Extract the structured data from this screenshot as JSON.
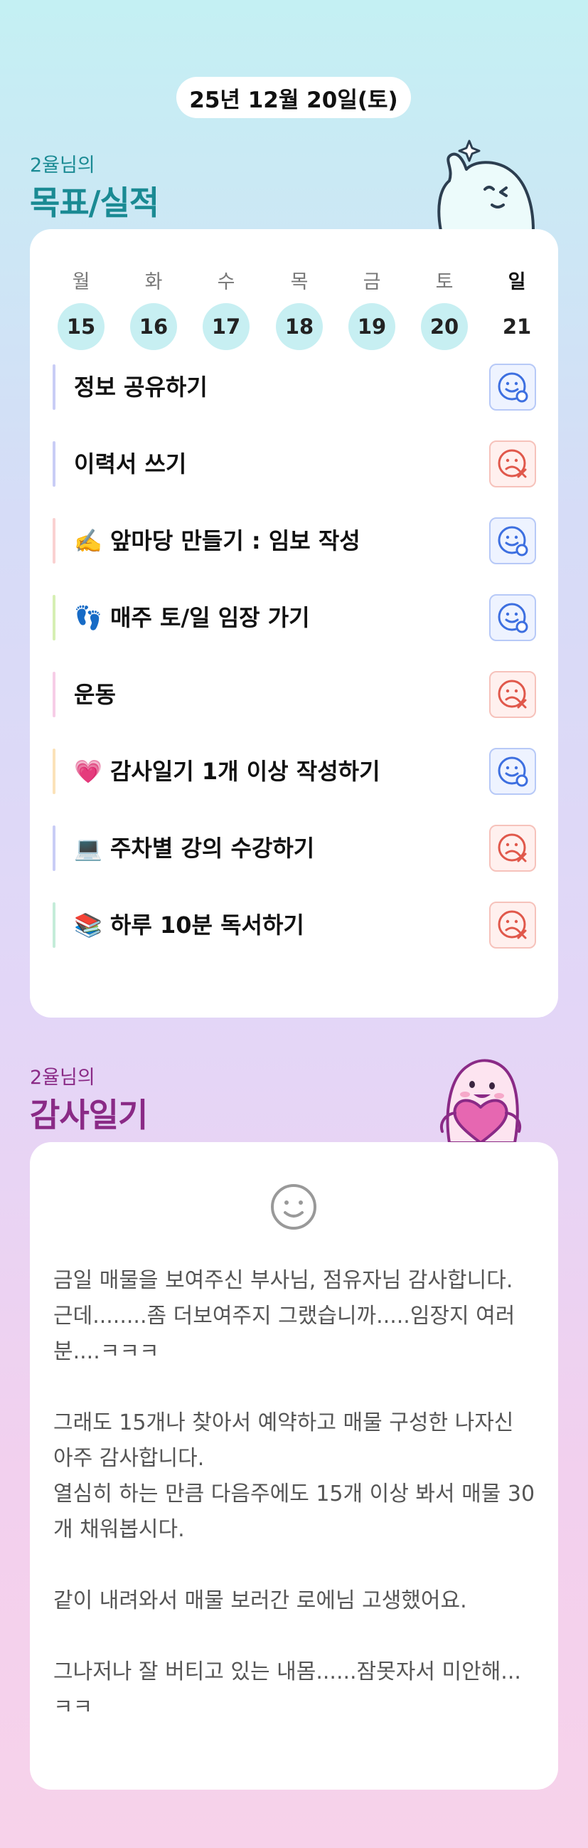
{
  "date": "25년 12월 20일(토)",
  "goal_section": {
    "owner": "2율님의",
    "title": "목표/실적"
  },
  "gratitude_section": {
    "owner": "2율님의",
    "title": "감사일기"
  },
  "week": [
    {
      "name": "월",
      "date": "15",
      "today": false
    },
    {
      "name": "화",
      "date": "16",
      "today": false
    },
    {
      "name": "수",
      "date": "17",
      "today": false
    },
    {
      "name": "목",
      "date": "18",
      "today": false
    },
    {
      "name": "금",
      "date": "19",
      "today": false
    },
    {
      "name": "토",
      "date": "20",
      "today": false
    },
    {
      "name": "일",
      "date": "21",
      "today": true
    }
  ],
  "goals": [
    {
      "text": "정보 공유하기",
      "status": "success",
      "bar_color": "#c9cdf6"
    },
    {
      "text": "이력서 쓰기",
      "status": "fail",
      "bar_color": "#c9cdf6"
    },
    {
      "text": "✍️ 앞마당 만들기 : 임보 작성",
      "status": "success",
      "bar_color": "#fad1d1"
    },
    {
      "text": "👣 매주 토/일 임장 가기",
      "status": "success",
      "bar_color": "#d6efb3"
    },
    {
      "text": "운동",
      "status": "fail",
      "bar_color": "#f7cde7"
    },
    {
      "text": "💗 감사일기 1개 이상 작성하기",
      "status": "success",
      "bar_color": "#fbe2b9"
    },
    {
      "text": "💻 주차별 강의 수강하기",
      "status": "fail",
      "bar_color": "#c9cdf6"
    },
    {
      "text": "📚 하루 10분 독서하기",
      "status": "fail",
      "bar_color": "#c4ecd9"
    }
  ],
  "diary_text": "금일 매물을 보여주신 부사님, 점유자님 감사합니다.\n근데........좀 더보여주지 그랬습니까.....임장지 여러분....ㅋㅋㅋ\n\n그래도 15개나 찾아서 예약하고 매물 구성한 나자신 아주 감사합니다.\n열심히 하는 만큼 다음주에도 15개 이상 봐서 매물 30개 채워봅시다.\n\n같이 내려와서 매물 보러간 로에님 고생했어요.\n\n그나저나 잘 버티고 있는 내몸......잠못자서 미안해...ㅋㅋ",
  "colors": {
    "success_icon": "#3d6fe0",
    "fail_icon": "#e0584b",
    "goal_title": "#1a8a93",
    "gratitude_title": "#8a2a86"
  },
  "icons": {
    "success": "smile-check-icon",
    "fail": "sad-x-icon",
    "diary_mood": "smile-face-icon"
  }
}
